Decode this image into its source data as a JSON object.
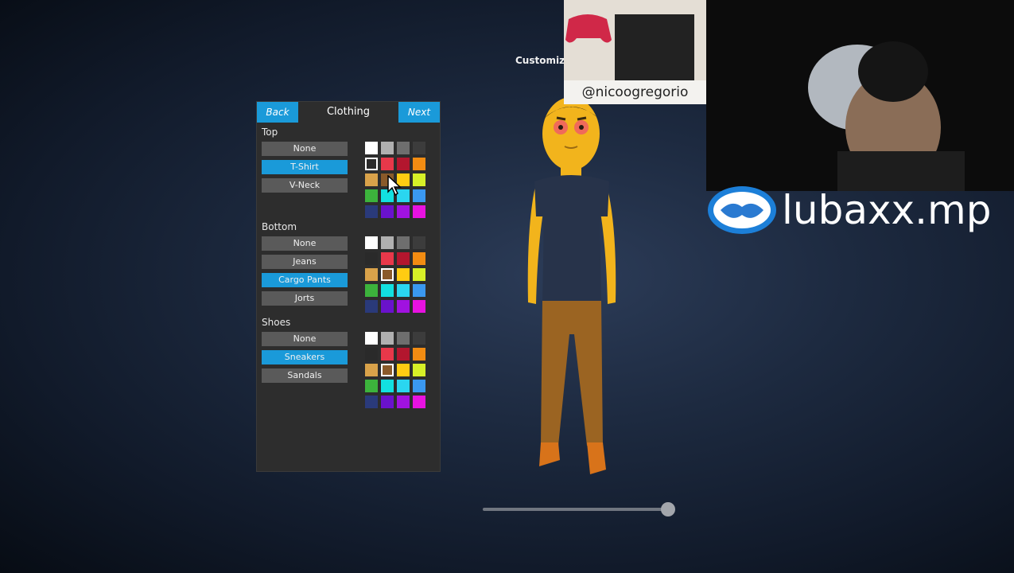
{
  "screen_title": "Customiz",
  "panel": {
    "back_label": "Back",
    "title": "Clothing",
    "next_label": "Next",
    "sections": [
      {
        "label": "Top",
        "options": [
          "None",
          "T-Shirt",
          "V-Neck"
        ],
        "selected": "T-Shirt",
        "selected_color_index": 4
      },
      {
        "label": "Bottom",
        "options": [
          "None",
          "Jeans",
          "Cargo Pants",
          "Jorts"
        ],
        "selected": "Cargo Pants",
        "selected_color_index": 9
      },
      {
        "label": "Shoes",
        "options": [
          "None",
          "Sneakers",
          "Sandals"
        ],
        "selected": "Sneakers",
        "selected_color_index": 9
      }
    ],
    "palette": [
      "#ffffff",
      "#b0b0b0",
      "#6e6e6e",
      "#3c3c3c",
      "#2a2a2a",
      "#e8384a",
      "#b3162e",
      "#f28c12",
      "#d9a24a",
      "#8a5a2a",
      "#ffcc12",
      "#d7f027",
      "#3cb33c",
      "#12e0e0",
      "#2ad6f0",
      "#3a98f0",
      "#2a3a7a",
      "#6a12cc",
      "#a012e0",
      "#e812e0"
    ]
  },
  "zoom_slider": {
    "value": 1.0
  },
  "overlays": {
    "sponsor_handle": "@nicoogregorio",
    "banner_text": "lubaxx.mp"
  },
  "colors": {
    "accent": "#1a9ad9",
    "button": "#5a5a5a",
    "panel": "#2d2d2d",
    "skin": "#f2b41c",
    "shirt": "#27334a",
    "pants": "#9b6422"
  }
}
